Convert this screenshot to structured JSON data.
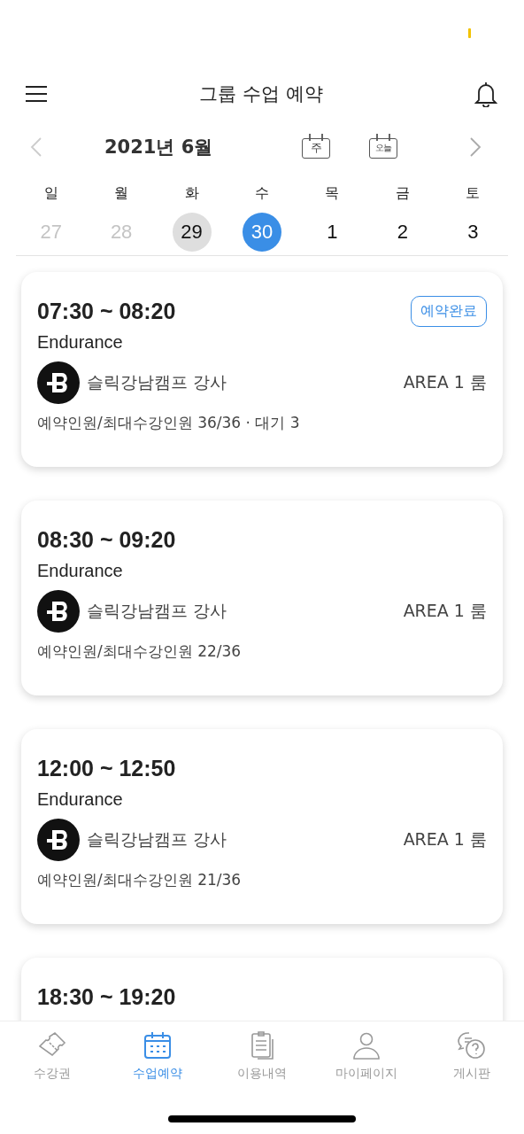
{
  "header": {
    "title": "그룹 수업 예약"
  },
  "calendar": {
    "month": "2021년 6월",
    "week_button": "주",
    "today_button": "오늘",
    "weekdays": [
      "일",
      "월",
      "화",
      "수",
      "목",
      "금",
      "토"
    ],
    "dates": [
      {
        "label": "27",
        "muted": true,
        "today": false,
        "selected": false
      },
      {
        "label": "28",
        "muted": true,
        "today": false,
        "selected": false
      },
      {
        "label": "29",
        "muted": false,
        "today": true,
        "selected": false
      },
      {
        "label": "30",
        "muted": false,
        "today": false,
        "selected": true
      },
      {
        "label": "1",
        "muted": false,
        "today": false,
        "selected": false
      },
      {
        "label": "2",
        "muted": false,
        "today": false,
        "selected": false
      },
      {
        "label": "3",
        "muted": false,
        "today": false,
        "selected": false
      }
    ]
  },
  "classes": [
    {
      "time": "07:30 ~ 08:20",
      "name": "Endurance",
      "instructor": "슬릭강남캠프 강사",
      "room": "AREA 1 룸",
      "capacity": "예약인원/최대수강인원 36/36 · 대기 3",
      "badge": "예약완료"
    },
    {
      "time": "08:30 ~ 09:20",
      "name": "Endurance",
      "instructor": "슬릭강남캠프 강사",
      "room": "AREA 1 룸",
      "capacity": "예약인원/최대수강인원 22/36"
    },
    {
      "time": "12:00 ~ 12:50",
      "name": "Endurance",
      "instructor": "슬릭강남캠프 강사",
      "room": "AREA 1 룸",
      "capacity": "예약인원/최대수강인원 21/36"
    },
    {
      "time": "18:30 ~ 19:20"
    }
  ],
  "tabs": [
    {
      "label": "수강권",
      "kind": "ticket",
      "selected": false
    },
    {
      "label": "수업예약",
      "kind": "calendar",
      "selected": true
    },
    {
      "label": "이용내역",
      "kind": "clipboard",
      "selected": false
    },
    {
      "label": "마이페이지",
      "kind": "person",
      "selected": false
    },
    {
      "label": "게시판",
      "kind": "chat",
      "selected": false
    }
  ]
}
